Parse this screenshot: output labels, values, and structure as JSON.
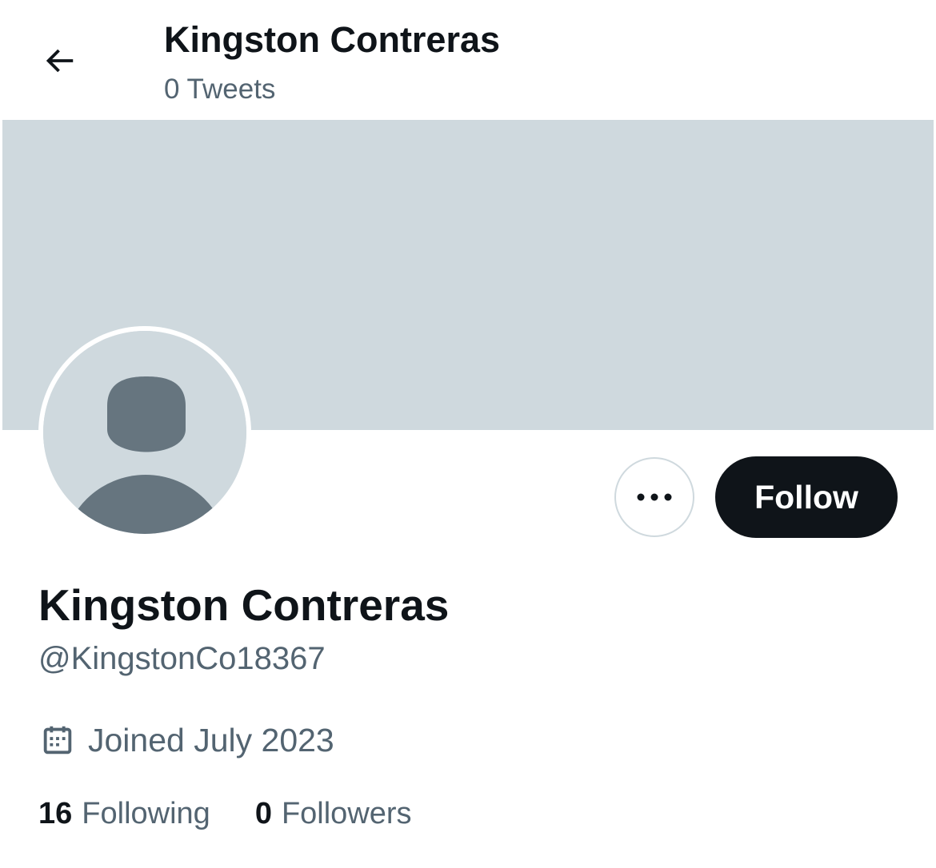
{
  "header": {
    "title": "Kingston Contreras",
    "subtitle": "0 Tweets",
    "back_icon": "arrow-left-icon"
  },
  "banner": {
    "color": "#cfd9de"
  },
  "avatar": {
    "icon": "default-avatar-silhouette",
    "background": "#cfd9de",
    "silhouette_color": "#66757f"
  },
  "actions": {
    "more_icon": "ellipsis-icon",
    "follow_label": "Follow"
  },
  "profile": {
    "display_name": "Kingston Contreras",
    "handle": "@KingstonCo18367",
    "joined_icon": "calendar-icon",
    "joined": "Joined July 2023"
  },
  "stats": {
    "following_count": "16",
    "following_label": "Following",
    "followers_count": "0",
    "followers_label": "Followers"
  },
  "colors": {
    "text_primary": "#0f1419",
    "text_secondary": "#536471",
    "button_dark": "#0f1419",
    "border": "#cfd9de"
  }
}
